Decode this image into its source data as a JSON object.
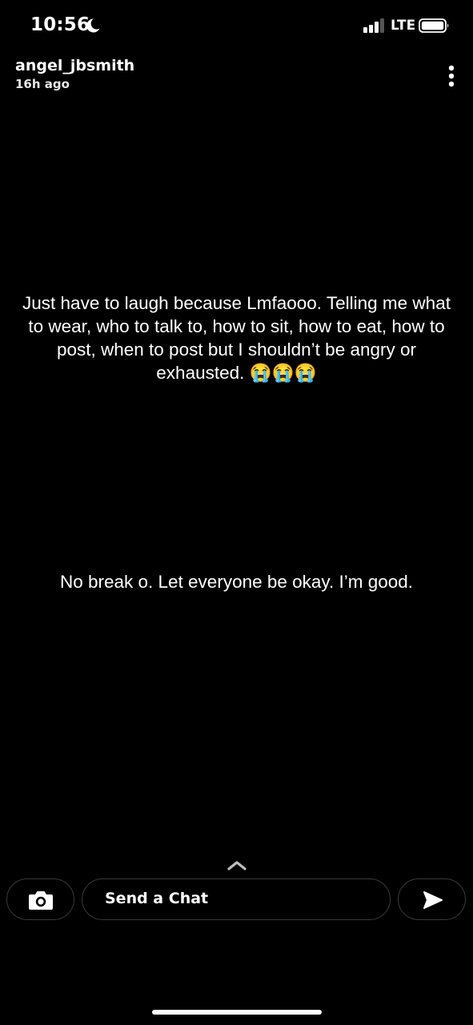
{
  "status_bar": {
    "time": "10:56",
    "network": "LTE",
    "icons": [
      "moon-icon",
      "signal-icon",
      "battery-icon"
    ]
  },
  "story": {
    "username": "angel_jbsmith",
    "timestamp": "16h ago",
    "primary_text": "Just have to laugh because Lmfaooo. Telling me what to wear, who to talk to, how to sit, how to eat, how to post, when to post but I shouldn’t be angry or exhausted. 😭😭😭",
    "secondary_text": "No break o. Let everyone be okay. I’m good."
  },
  "chat_bar": {
    "placeholder": "Send a Chat",
    "icons": [
      "camera-icon",
      "send-icon",
      "swipe-up-icon",
      "more-vertical-icon"
    ]
  }
}
